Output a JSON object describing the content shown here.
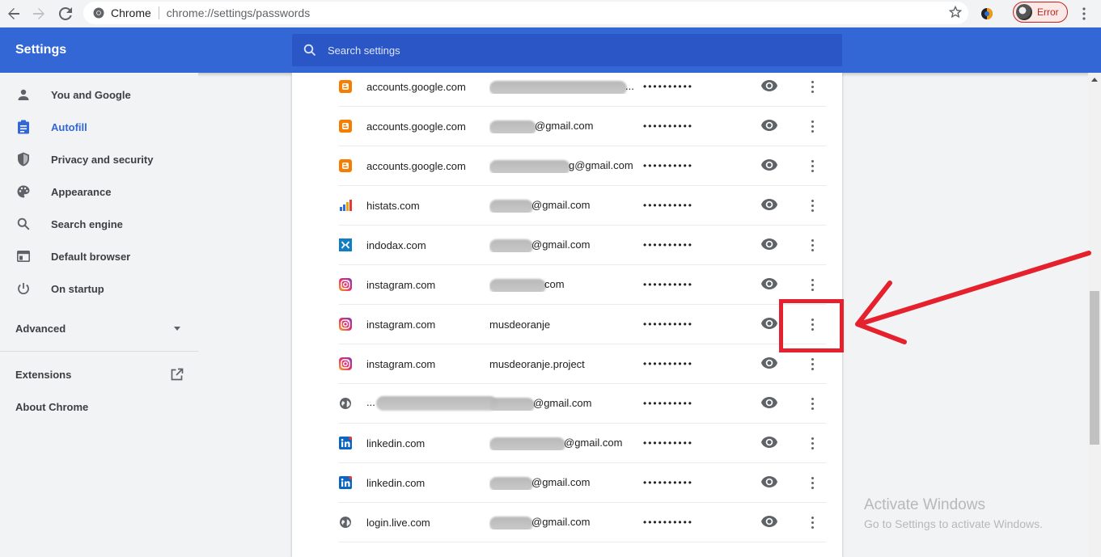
{
  "browser": {
    "site_label": "Chrome",
    "url": "chrome://settings/passwords",
    "profile_status": "Error"
  },
  "header": {
    "title": "Settings",
    "search_placeholder": "Search settings"
  },
  "sidebar": {
    "items": [
      {
        "label": "You and Google",
        "icon": "person-icon",
        "active": false
      },
      {
        "label": "Autofill",
        "icon": "clipboard-icon",
        "active": true
      },
      {
        "label": "Privacy and security",
        "icon": "shield-icon",
        "active": false
      },
      {
        "label": "Appearance",
        "icon": "palette-icon",
        "active": false
      },
      {
        "label": "Search engine",
        "icon": "search-icon",
        "active": false
      },
      {
        "label": "Default browser",
        "icon": "browser-icon",
        "active": false
      },
      {
        "label": "On startup",
        "icon": "power-icon",
        "active": false
      }
    ],
    "advanced_label": "Advanced",
    "extensions_label": "Extensions",
    "about_label": "About Chrome"
  },
  "passwords": [
    {
      "site": "accounts.google.com",
      "user": "...",
      "password": "••••••••••",
      "icon": "blogger-icon"
    },
    {
      "site": "accounts.google.com",
      "user": "@gmail.com",
      "password": "••••••••••",
      "icon": "blogger-icon"
    },
    {
      "site": "accounts.google.com",
      "user": "g@gmail.com",
      "password": "••••••••••",
      "icon": "blogger-icon"
    },
    {
      "site": "histats.com",
      "user": "@gmail.com",
      "password": "••••••••••",
      "icon": "histats-icon"
    },
    {
      "site": "indodax.com",
      "user": "@gmail.com",
      "password": "••••••••••",
      "icon": "indodax-icon"
    },
    {
      "site": "instagram.com",
      "user": "com",
      "password": "••••••••••",
      "icon": "instagram-icon"
    },
    {
      "site": "instagram.com",
      "user": "musdeoranje",
      "password": "••••••••••",
      "icon": "instagram-icon"
    },
    {
      "site": "instagram.com",
      "user": "musdeoranje.project",
      "password": "••••••••••",
      "icon": "instagram-icon"
    },
    {
      "site": "...",
      "user": "@gmail.com",
      "password": "••••••••••",
      "icon": "globe-icon"
    },
    {
      "site": "linkedin.com",
      "user": "@gmail.com",
      "password": "••••••••••",
      "icon": "linkedin-icon"
    },
    {
      "site": "linkedin.com",
      "user": "@gmail.com",
      "password": "••••••••••",
      "icon": "linkedin-icon"
    },
    {
      "site": "login.live.com",
      "user": "@gmail.com",
      "password": "••••••••••",
      "icon": "globe-icon"
    }
  ],
  "watermark": {
    "line1": "Activate Windows",
    "line2": "Go to Settings to activate Windows."
  },
  "colors": {
    "header_blue": "#3367d6",
    "annotation_red": "#e4212c"
  }
}
